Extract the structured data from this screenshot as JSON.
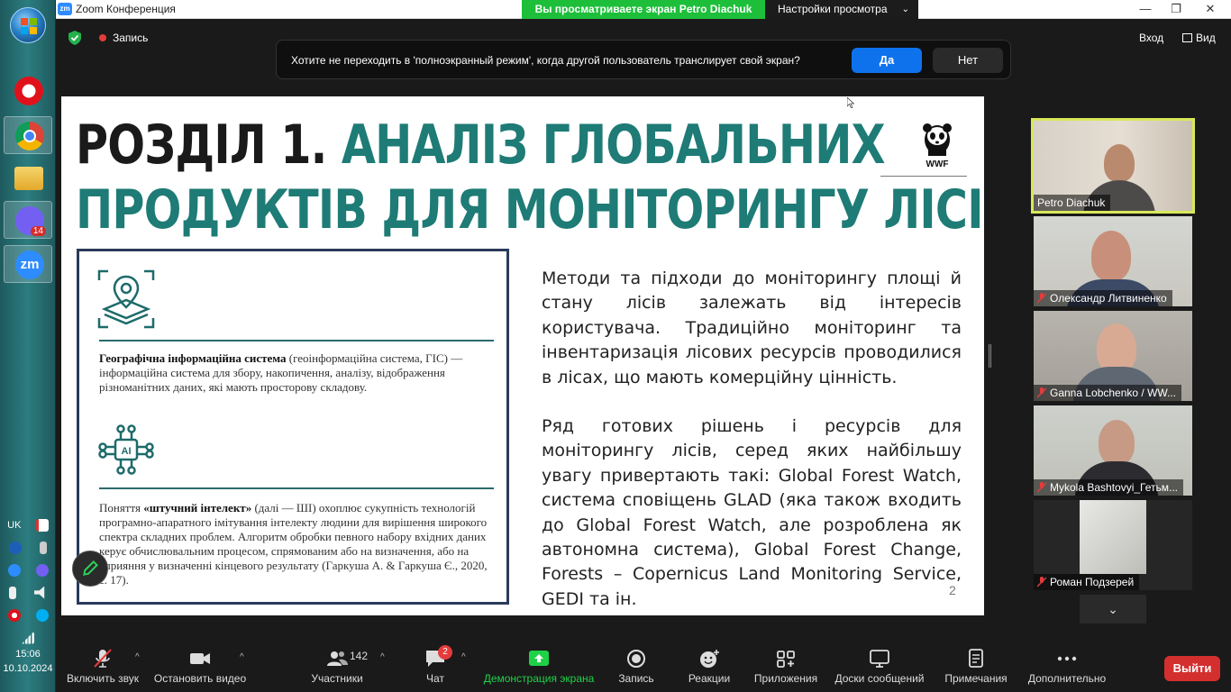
{
  "os_taskbar": {
    "apps": [
      {
        "name": "opera",
        "icon": "opera-icon"
      },
      {
        "name": "chrome",
        "icon": "chrome-icon"
      },
      {
        "name": "explorer",
        "icon": "folder-icon"
      },
      {
        "name": "viber",
        "icon": "viber-icon",
        "badge": "14"
      },
      {
        "name": "zoom",
        "icon": "zoom-icon",
        "label": "zm"
      }
    ],
    "tray": {
      "language": "UK"
    },
    "clock": {
      "time": "15:06",
      "date": "10.10.2024"
    }
  },
  "window": {
    "logo": "zm",
    "title": "Zoom Конференция",
    "share_banner": "Вы просматриваете экран Petro Diachuk",
    "view_settings": "Настройки просмотра"
  },
  "topbar": {
    "record_label": "Запись",
    "enter_label": "Вход",
    "view_label": "Вид"
  },
  "fullscreen_prompt": {
    "text": "Хотите не переходить в 'полноэкранный режим', когда другой пользователь транслирует свой экран?",
    "yes": "Да",
    "no": "Нет"
  },
  "slide": {
    "title_black": "РОЗДІЛ 1.",
    "title_teal_1": "АНАЛІЗ ГЛОБАЛЬНИХ",
    "title_teal_2": "ПРОДУКТІВ ДЛЯ МОНІТОРИНГУ ЛІСІВ",
    "logo_text": "WWF",
    "box": {
      "gis_term": "Географічна інформаційна система",
      "gis_text": " (геоінформаційна система, ГІС) — інформаційна система для збору, накопичення, аналізу, відображення різноманітних даних, які мають просторову складову.",
      "ai_icon_label": "AI",
      "ai_prefix": "Поняття ",
      "ai_term": "«штучний інтелект»",
      "ai_text": " (далі — ШІ) охоплює сукупність технологій програмно-апаратного імітування інтелекту людини для вирішення широкого спектра складних проблем. Алгоритм обробки певного набору вхідних даних керує обчислювальним процесом, спрямованим або на визначення, або на сприяння у визначенні кінцевого результату (Гаркуша А. & Гаркуша Є., 2020, с. 17)."
    },
    "paragraph_1": "Методи та підходи до моніторингу площі й стану лісів залежать від інтересів користувача. Традиційно моніторинг та інвентаризація лісових ресурсів проводилися в лісах, що мають комерційну цінність.",
    "paragraph_2": "Ряд готових рішень і ресурсів для моніторингу лісів, серед яких найбільшу увагу привертають такі: Global Forest Watch, система сповіщень GLAD (яка також входить до Global Forest Watch, але розроблена як автономна система), Global Forest Change, Forests – Copernicus Land Monitoring Service, GEDI та ін.",
    "page_number": "2"
  },
  "participants": [
    {
      "name": "Petro Diachuk",
      "muted": false,
      "active": true
    },
    {
      "name": "Олександр Литвиненко",
      "muted": true
    },
    {
      "name": "Ganna Lobchenko / WW...",
      "muted": true
    },
    {
      "name": "Mykola Bashtovyi_Гетьм...",
      "muted": true
    },
    {
      "name": "Роман Подзерей",
      "muted": true
    }
  ],
  "toolbar": {
    "unmute": "Включить звук",
    "stop_video": "Остановить видео",
    "participants": "Участники",
    "participants_count": "142",
    "chat": "Чат",
    "chat_badge": "2",
    "share": "Демонстрация экрана",
    "record": "Запись",
    "reactions": "Реакции",
    "apps": "Приложения",
    "whiteboards": "Доски сообщений",
    "notes": "Примечания",
    "more": "Дополнительно",
    "leave": "Выйти"
  },
  "colors": {
    "share_green": "#1dbf3a",
    "primary_blue": "#0e72ed",
    "leave_red": "#d32f2f",
    "slide_teal": "#1e7b76",
    "active_speaker": "#d8e85a"
  }
}
